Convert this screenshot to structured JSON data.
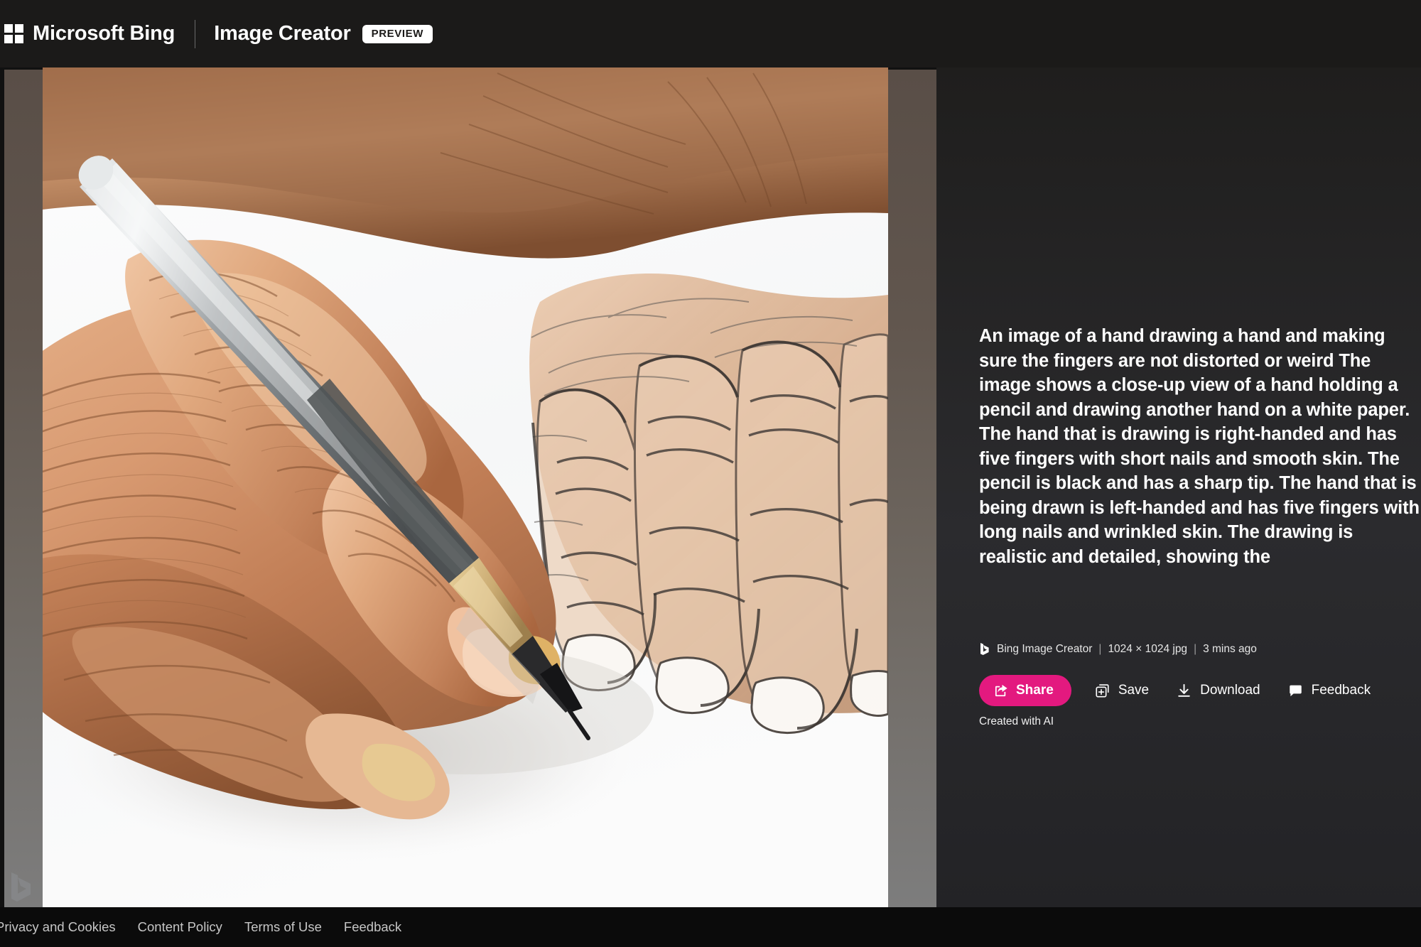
{
  "header": {
    "logo_icon": "microsoft-grid-icon",
    "wordmark": "Microsoft Bing",
    "product": "Image Creator",
    "preview_badge": "PREVIEW"
  },
  "stage": {
    "watermark_icon": "bing-b-watermark-icon",
    "alt": "AI generated photo: close-up of a wrinkled hand holding a grey pencil, drawing a detailed sketch of another hand on white paper"
  },
  "panel": {
    "prompt": "An image of a hand drawing a hand and making sure the fingers are not distorted or weird The image shows a close-up view of a hand holding a pencil and drawing another hand on a white paper. The hand that is drawing is right-handed and has five fingers with short nails and smooth skin. The pencil is black and has a sharp tip. The hand that is being drawn is left-handed and has five fingers with long nails and wrinkled skin. The drawing is realistic and detailed, showing the",
    "meta": {
      "source_icon": "bing-b-icon",
      "source": "Bing Image Creator",
      "separator": "|",
      "dimensions": "1024 × 1024 jpg",
      "time": "3 mins ago"
    },
    "actions": {
      "share": {
        "label": "Share",
        "icon": "share-icon",
        "color": "#e3197f"
      },
      "save": {
        "label": "Save",
        "icon": "save-collection-icon"
      },
      "download": {
        "label": "Download",
        "icon": "download-icon"
      },
      "feedback": {
        "label": "Feedback",
        "icon": "feedback-bubble-icon"
      }
    },
    "attribution": "Created with AI"
  },
  "footer": {
    "links": [
      {
        "label": "Privacy and Cookies"
      },
      {
        "label": "Content Policy"
      },
      {
        "label": "Terms of Use"
      },
      {
        "label": "Feedback"
      }
    ]
  },
  "theme": {
    "header_bg": "#1b1a19",
    "panel_bg": "#2b2b2e",
    "footer_bg": "#0b0b0b",
    "accent": "#e3197f",
    "backdrop_top": "#594e47",
    "backdrop_bottom": "#7d7d7d"
  }
}
